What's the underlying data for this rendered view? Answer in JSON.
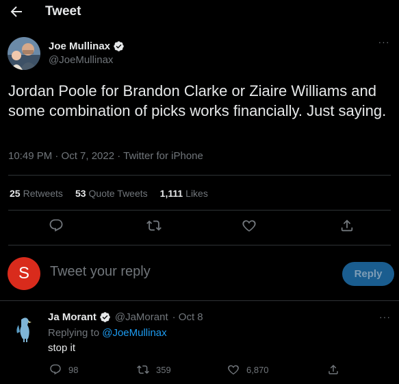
{
  "header": {
    "title": "Tweet"
  },
  "tweet": {
    "author_name": "Joe Mullinax",
    "author_handle": "@JoeMullinax",
    "text": "Jordan Poole for Brandon Clarke or Ziaire Williams and some combination of picks works financially. Just saying.",
    "meta": "10:49 PM · Oct 7, 2022 · Twitter for iPhone"
  },
  "stats": {
    "retweets_count": "25",
    "retweets_label": "Retweets",
    "quotes_count": "53",
    "quotes_label": "Quote Tweets",
    "likes_count": "1,111",
    "likes_label": "Likes"
  },
  "compose": {
    "avatar_letter": "S",
    "placeholder": "Tweet your reply",
    "reply_button": "Reply"
  },
  "reply": {
    "name": "Ja Morant",
    "handle": "@JaMorant",
    "date": "· Oct 8",
    "replying_prefix": "Replying to ",
    "replying_to": "@JoeMullinax",
    "text": "stop it",
    "replies": "98",
    "retweets": "359",
    "likes": "6,870"
  },
  "colors": {
    "background": "#000000",
    "text": "#e7e9ea",
    "muted": "#71767b",
    "accent": "#1d9bf0",
    "divider": "#2f3336",
    "reply_button": "#1a5d8f",
    "avatar_s": "#d92b1c"
  }
}
